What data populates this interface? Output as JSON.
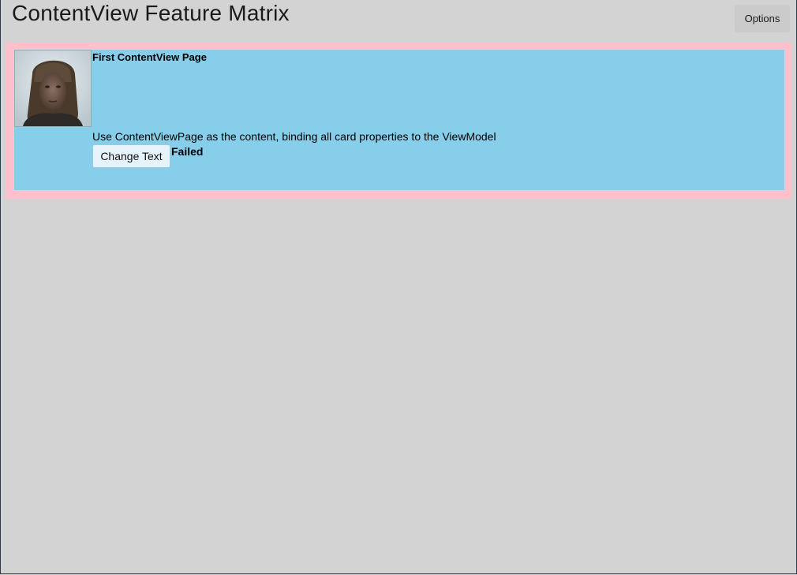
{
  "header": {
    "title": "ContentView Feature Matrix",
    "options_label": "Options"
  },
  "card": {
    "title": "First ContentView Page",
    "description": "Use ContentViewPage as the content, binding all card properties to the ViewModel",
    "button_label": "Change Text",
    "status": "Failed",
    "border_color": "#ffc0cb",
    "background_color": "#87ceeb",
    "avatar": "avatar-photo"
  }
}
